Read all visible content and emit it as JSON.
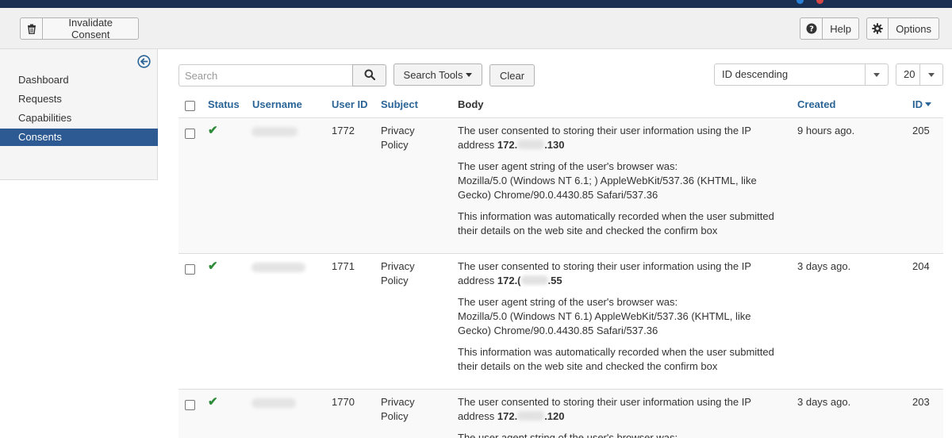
{
  "toolbar": {
    "invalidate_label": "Invalidate Consent",
    "help_label": "Help",
    "options_label": "Options"
  },
  "sidebar": {
    "items": [
      {
        "label": "Dashboard"
      },
      {
        "label": "Requests"
      },
      {
        "label": "Capabilities"
      },
      {
        "label": "Consents",
        "active": true
      }
    ]
  },
  "filters": {
    "search_placeholder": "Search",
    "search_tools_label": "Search Tools",
    "clear_label": "Clear",
    "ordering": "ID descending",
    "limit": "20"
  },
  "table": {
    "headers": {
      "status": "Status",
      "username": "Username",
      "user_id": "User ID",
      "subject": "Subject",
      "body": "Body",
      "created": "Created",
      "id": "ID"
    },
    "rows": [
      {
        "user_id": "1772",
        "subject_line1": "Privacy",
        "subject_line2": "Policy",
        "ip_prefix": "172.",
        "ip_suffix": ".130",
        "created": "9 hours ago.",
        "id": "205"
      },
      {
        "user_id": "1771",
        "subject_line1": "Privacy",
        "subject_line2": "Policy",
        "ip_prefix": "172.(",
        "ip_suffix": ".55",
        "created": "3 days ago.",
        "id": "204"
      },
      {
        "user_id": "1770",
        "subject_line1": "Privacy",
        "subject_line2": "Policy",
        "ip_prefix": "172.",
        "ip_suffix": ".120",
        "created": "3 days ago.",
        "id": "203"
      }
    ],
    "body_text": {
      "consent_line1": "The user consented to storing their user information using the IP",
      "consent_line2": "address",
      "ua_intro": "The user agent string of the user's browser was:",
      "ua_line1": "Mozilla/5.0 (Windows NT 6.1; ) AppleWebKit/537.36 (KHTML, like",
      "ua_line2": "Gecko) Chrome/90.0.4430.85 Safari/537.36",
      "ua_line1_b": "Mozilla/5.0 (Windows NT 6.1) AppleWebKit/537.36 (KHTML, like",
      "auto_line1": "This information was automatically recorded when the user submitted",
      "auto_line2": "their details on the web site and checked the confirm box",
      "ua_intro_partial": "The user agent string of the user's browser was:"
    }
  }
}
